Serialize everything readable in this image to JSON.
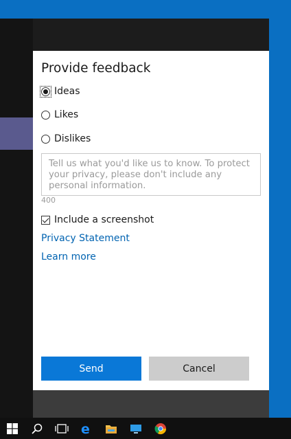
{
  "dialog": {
    "title": "Provide feedback",
    "options": [
      {
        "label": "Ideas",
        "selected": true
      },
      {
        "label": "Likes",
        "selected": false
      },
      {
        "label": "Dislikes",
        "selected": false
      }
    ],
    "feedback_placeholder": "Tell us what you'd like us to know. To protect your privacy, please don't include any personal information.",
    "char_count": "400",
    "include_screenshot_label": "Include a screenshot",
    "include_screenshot_checked": true,
    "privacy_link": "Privacy Statement",
    "learn_more_link": "Learn more",
    "send_label": "Send",
    "cancel_label": "Cancel"
  },
  "taskbar": {
    "items": [
      "windows-start-icon",
      "search-icon",
      "task-view-icon",
      "edge-browser-icon",
      "file-explorer-icon",
      "desktop-app-icon",
      "chrome-icon"
    ]
  },
  "colors": {
    "accent": "#0a78d7",
    "link": "#0063b1",
    "desktop": "#0a6fc2"
  }
}
